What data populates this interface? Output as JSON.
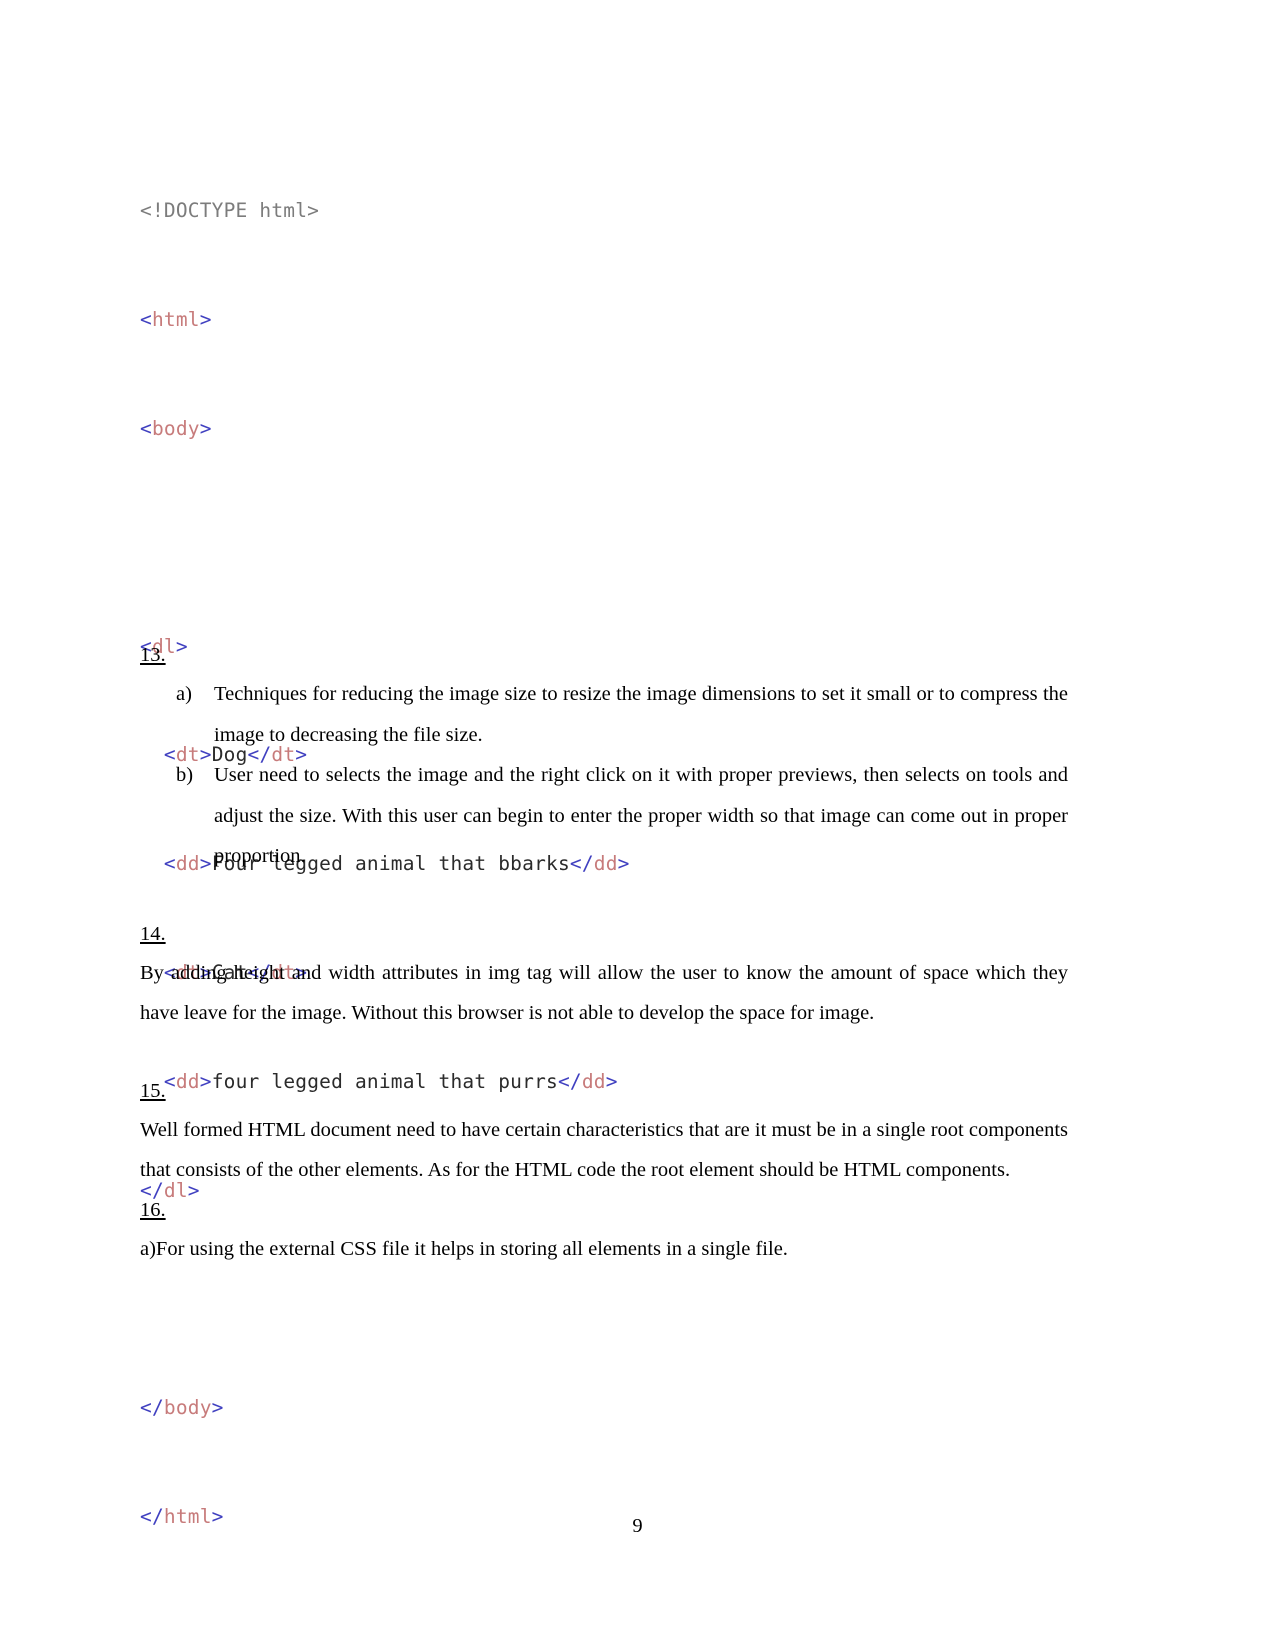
{
  "document": {
    "page_number": "9"
  },
  "code_block": {
    "language": "html",
    "colors": {
      "doctype": "#7c7c7c",
      "bracket": "#4040c0",
      "tag": "#c77b7b",
      "text": "#2b2b2b"
    },
    "lines": [
      {
        "id": "doctype",
        "text": "<!DOCTYPE html>"
      },
      {
        "id": "html-open",
        "text": "<html>"
      },
      {
        "id": "body-open",
        "text": "<body>"
      },
      {
        "id": "blank-1",
        "text": ""
      },
      {
        "id": "dl-open",
        "text": "<dl>"
      },
      {
        "id": "dt-dog",
        "text": "  <dt>Dog</dt>"
      },
      {
        "id": "dd-dog",
        "text": "  <dd>Four legged animal that bbarks</dd>"
      },
      {
        "id": "dt-cat",
        "text": "  <dt>Cat</dt>"
      },
      {
        "id": "dd-cat",
        "text": "  <dd>four legged animal that purrs</dd>"
      },
      {
        "id": "dl-close",
        "text": "</dl>"
      },
      {
        "id": "blank-2",
        "text": ""
      },
      {
        "id": "body-close",
        "text": "</body>"
      },
      {
        "id": "html-close",
        "text": "</html>"
      }
    ]
  },
  "sections": {
    "s13": {
      "number": "13.",
      "items": [
        {
          "marker": "a)",
          "text": "Techniques for reducing the image size to resize the image dimensions to set it small or to compress the image to decreasing the file size."
        },
        {
          "marker": "b)",
          "text": "User need to selects the image and the right click on it with proper previews, then selects on tools and adjust the size. With this user can begin to enter the proper width so that image can come out in proper proportion."
        }
      ]
    },
    "s14": {
      "number": "14.",
      "paragraph": "By adding height and width attributes in img tag will allow the user to know the amount of space which they have leave for the image. Without this browser is not able to develop the space for image."
    },
    "s15": {
      "number": "15.",
      "paragraph": "Well formed HTML document need to have certain characteristics that are it must be in a single root components that consists of the other elements. As for the HTML code the root element should be HTML components."
    },
    "s16": {
      "number": "16.",
      "paragraph": "a)For using the external CSS file it helps in storing all elements in a single file."
    }
  }
}
